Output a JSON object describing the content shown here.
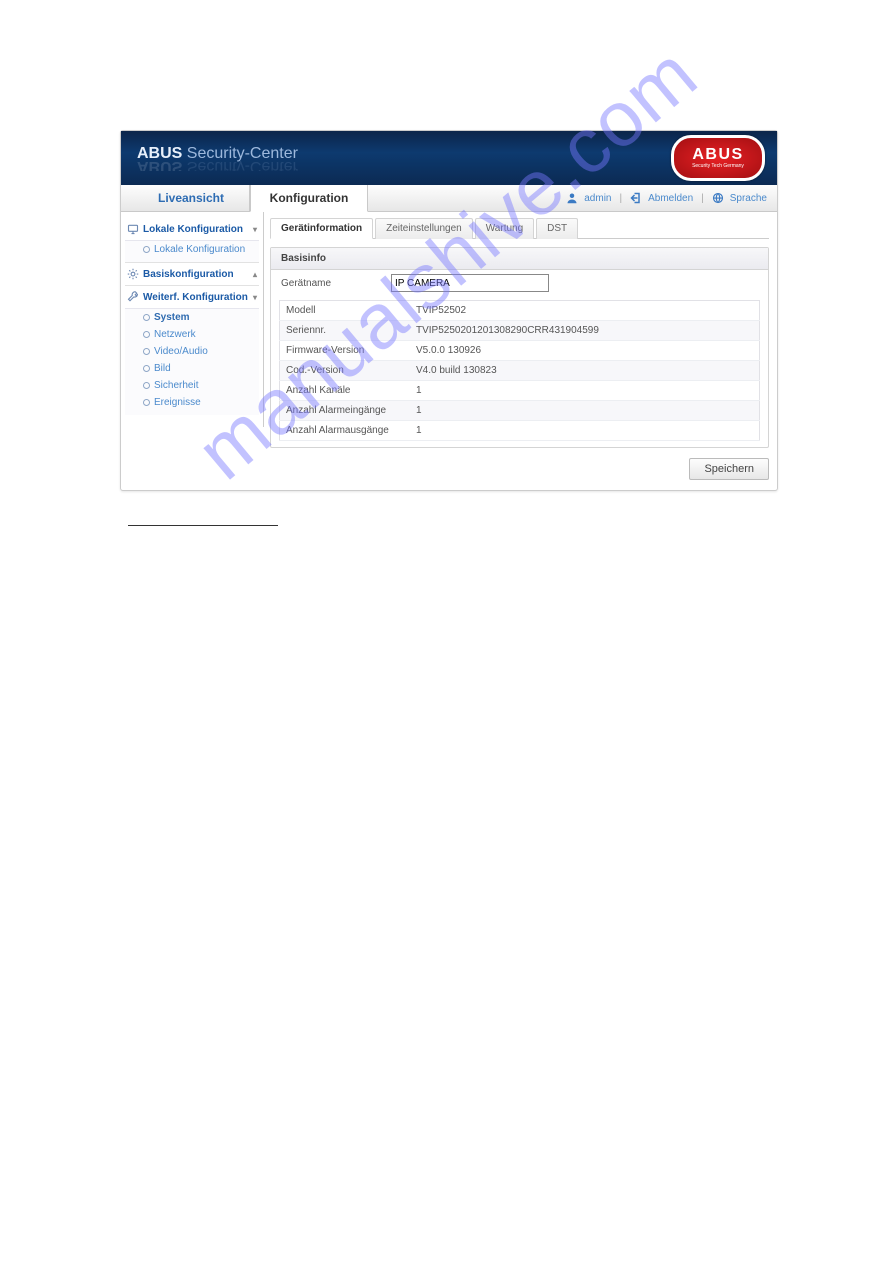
{
  "branding": {
    "name_strong": "ABUS",
    "name_light": "Security-Center",
    "logo_text": "ABUS",
    "logo_sub": "Security Tech Germany"
  },
  "topnav": {
    "tabs": [
      {
        "label": "Liveansicht",
        "active": false
      },
      {
        "label": "Konfiguration",
        "active": true
      }
    ],
    "user_label": "admin",
    "logout_label": "Abmelden",
    "language_label": "Sprache"
  },
  "sidebar": {
    "groups": [
      {
        "title": "Lokale Konfiguration",
        "expanded": true,
        "icon": "monitor-icon",
        "items": [
          {
            "label": "Lokale Konfiguration",
            "active": false
          }
        ]
      },
      {
        "title": "Basiskonfiguration",
        "expanded": false,
        "icon": "gear-icon",
        "items": []
      },
      {
        "title": "Weiterf. Konfiguration",
        "expanded": true,
        "icon": "wrench-icon",
        "items": [
          {
            "label": "System",
            "active": true
          },
          {
            "label": "Netzwerk",
            "active": false
          },
          {
            "label": "Video/Audio",
            "active": false
          },
          {
            "label": "Bild",
            "active": false
          },
          {
            "label": "Sicherheit",
            "active": false
          },
          {
            "label": "Ereignisse",
            "active": false
          }
        ]
      }
    ]
  },
  "content": {
    "subtabs": [
      {
        "label": "Gerätinformation",
        "active": true
      },
      {
        "label": "Zeiteinstellungen",
        "active": false
      },
      {
        "label": "Wartung",
        "active": false
      },
      {
        "label": "DST",
        "active": false
      }
    ],
    "panel_title": "Basisinfo",
    "device_name_label": "Gerätname",
    "device_name_value": "IP CAMERA",
    "rows": [
      {
        "k": "Modell",
        "v": "TVIP52502"
      },
      {
        "k": "Seriennr.",
        "v": "TVIP5250201201308290CRR431904599"
      },
      {
        "k": "Firmware-Version",
        "v": "V5.0.0 130926"
      },
      {
        "k": "Cod.-Version",
        "v": "V4.0 build 130823"
      },
      {
        "k": "Anzahl Kanäle",
        "v": "1"
      },
      {
        "k": "Anzahl Alarmeingänge",
        "v": "1"
      },
      {
        "k": "Anzahl Alarmausgänge",
        "v": "1"
      }
    ],
    "save_label": "Speichern"
  },
  "watermark": "manualshive.com"
}
